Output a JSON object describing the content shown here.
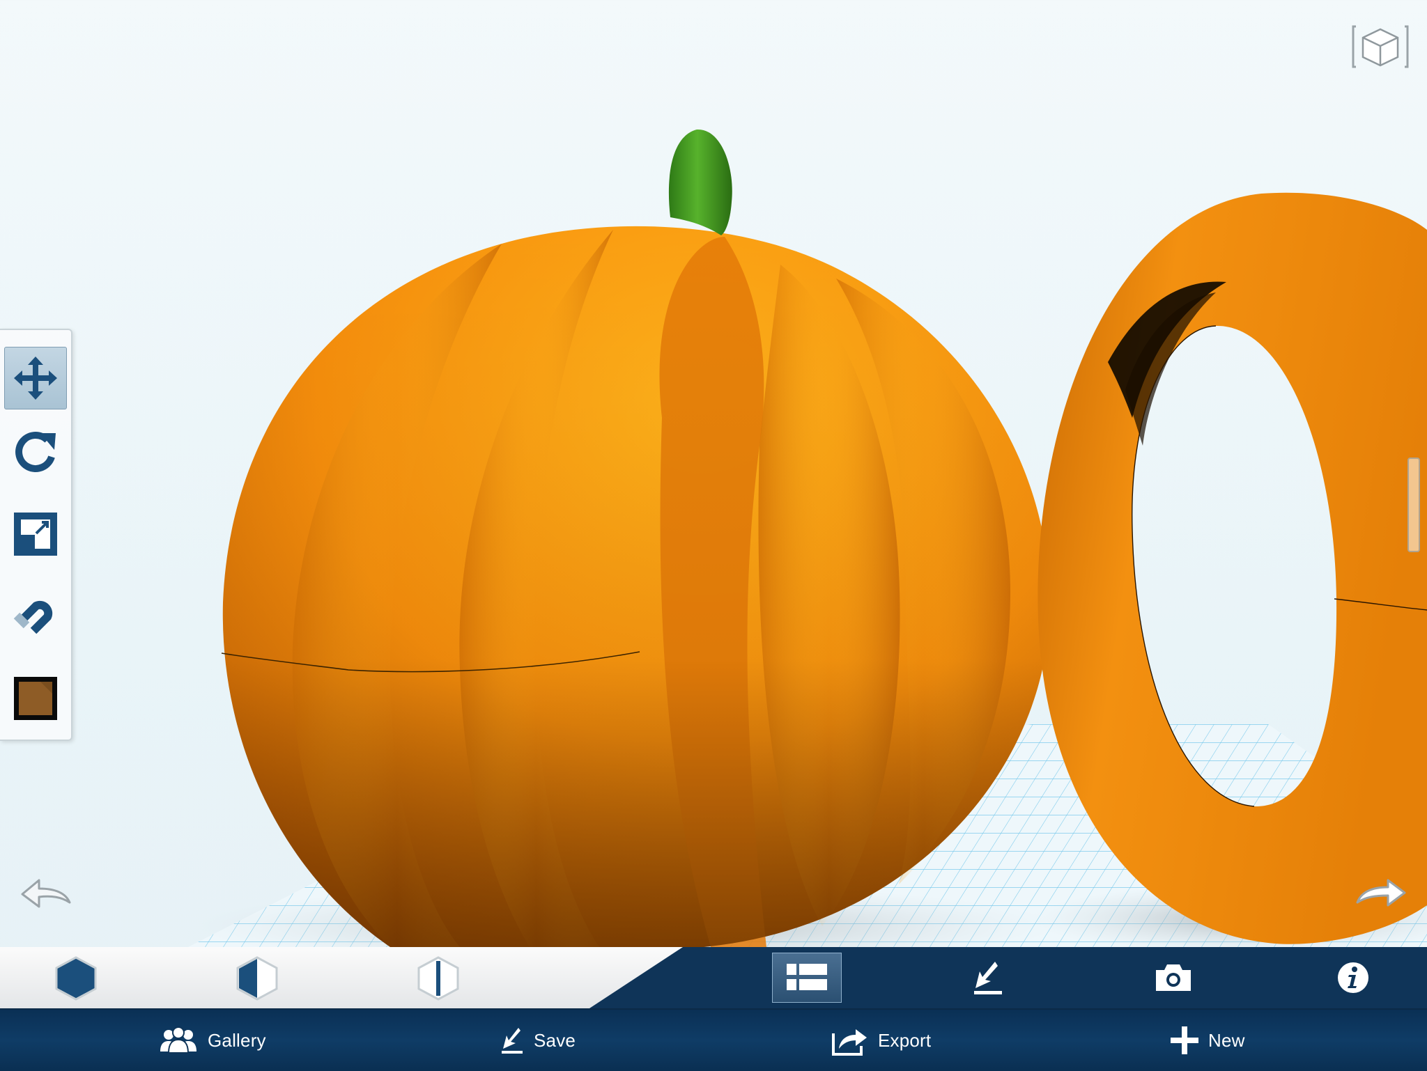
{
  "app": {
    "name": "3D modeling workspace"
  },
  "viewport": {
    "scene_objects": [
      {
        "name": "pumpkin",
        "color": "#f7940e"
      },
      {
        "name": "pumpkin-stem",
        "color": "#3e9a20"
      },
      {
        "name": "torus",
        "color": "#f08a0c"
      }
    ],
    "ground_grid_color": "#4fb3e0"
  },
  "tool_palette": {
    "tools": [
      {
        "id": "move",
        "icon": "move-arrows-icon",
        "active": true
      },
      {
        "id": "rotate",
        "icon": "rotate-icon",
        "active": false
      },
      {
        "id": "scale",
        "icon": "scale-icon",
        "active": false
      },
      {
        "id": "snap",
        "icon": "magnet-icon",
        "active": false
      },
      {
        "id": "material",
        "icon": "material-swatch-icon",
        "active": false,
        "color": "#7a4e1e"
      }
    ]
  },
  "mode_toolbar": {
    "modes": [
      {
        "id": "solid",
        "icon": "solid-hexagon-icon"
      },
      {
        "id": "half",
        "icon": "half-shaded-hexagon-icon"
      },
      {
        "id": "outline",
        "icon": "outline-hexagon-icon"
      }
    ],
    "icons": [
      {
        "id": "list-view",
        "icon": "list-icon",
        "active": true
      },
      {
        "id": "import",
        "icon": "download-icon"
      },
      {
        "id": "snapshot",
        "icon": "camera-icon"
      },
      {
        "id": "info",
        "icon": "info-icon"
      }
    ]
  },
  "bottom_bar": {
    "gallery_label": "Gallery",
    "save_label": "Save",
    "export_label": "Export",
    "new_label": "New"
  },
  "colors": {
    "toolbar_navy": "#0f3458",
    "accent_blue": "#1b4f7c"
  }
}
